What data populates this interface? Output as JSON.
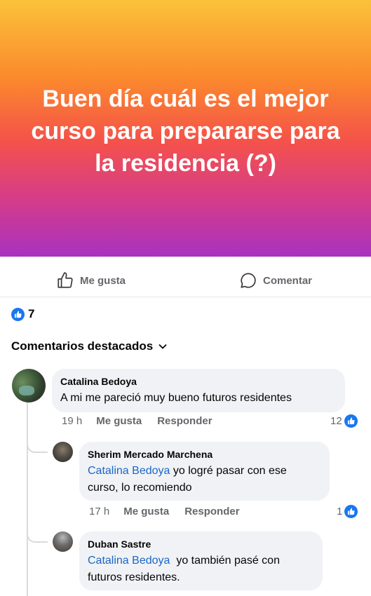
{
  "post": {
    "text": "Buen día cuál es el mejor curso para prepararse para la residencia (?)",
    "background": [
      "#fbc23a",
      "#fb8a2c",
      "#f5524a",
      "#d43c8a",
      "#a832c0"
    ]
  },
  "actions": {
    "like_label": "Me gusta",
    "comment_label": "Comentar"
  },
  "reactions": {
    "count": "7",
    "icon": "thumbs-up-icon"
  },
  "comments_header": {
    "label": "Comentarios destacados"
  },
  "comments": [
    {
      "author": "Catalina Bedoya",
      "text": "A mi me pareció muy bueno futuros residentes",
      "time": "19 h",
      "like_label": "Me gusta",
      "reply_label": "Responder",
      "likes": "12",
      "replies": [
        {
          "author": "Sherim Mercado Marchena",
          "mention": "Catalina Bedoya",
          "text_line1": " yo logré pasar con ese",
          "text_line2": "curso, lo recomiendo",
          "time": "17 h",
          "like_label": "Me gusta",
          "reply_label": "Responder",
          "likes": "1"
        },
        {
          "author": "Duban Sastre",
          "mention": "Catalina Bedoya",
          "text_line1": "  yo también pasé con",
          "text_line2": "futuros residentes."
        }
      ]
    }
  ],
  "colors": {
    "accent": "#1877f2",
    "mention": "#1b66c9",
    "muted": "#65676b",
    "bubble": "#f0f2f5"
  }
}
